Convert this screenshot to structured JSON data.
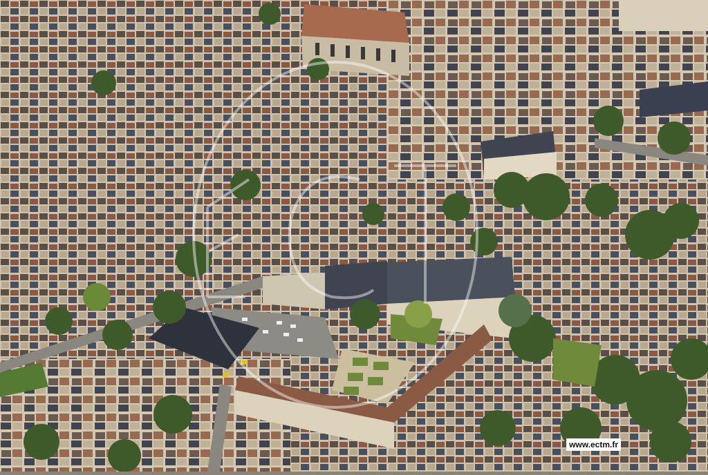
{
  "photo": {
    "subject": "aerial-city",
    "colors": {
      "roof_slate": "#3f4450",
      "roof_tile": "#8a5a44",
      "stone": "#d8ccb4",
      "tree": "#3f5a2a",
      "lawn": "#6e8a3a",
      "street": "#7e7c78"
    }
  },
  "watermark": {
    "text": "www.ectm.fr",
    "logo_label": "ectm-circle-logo"
  }
}
